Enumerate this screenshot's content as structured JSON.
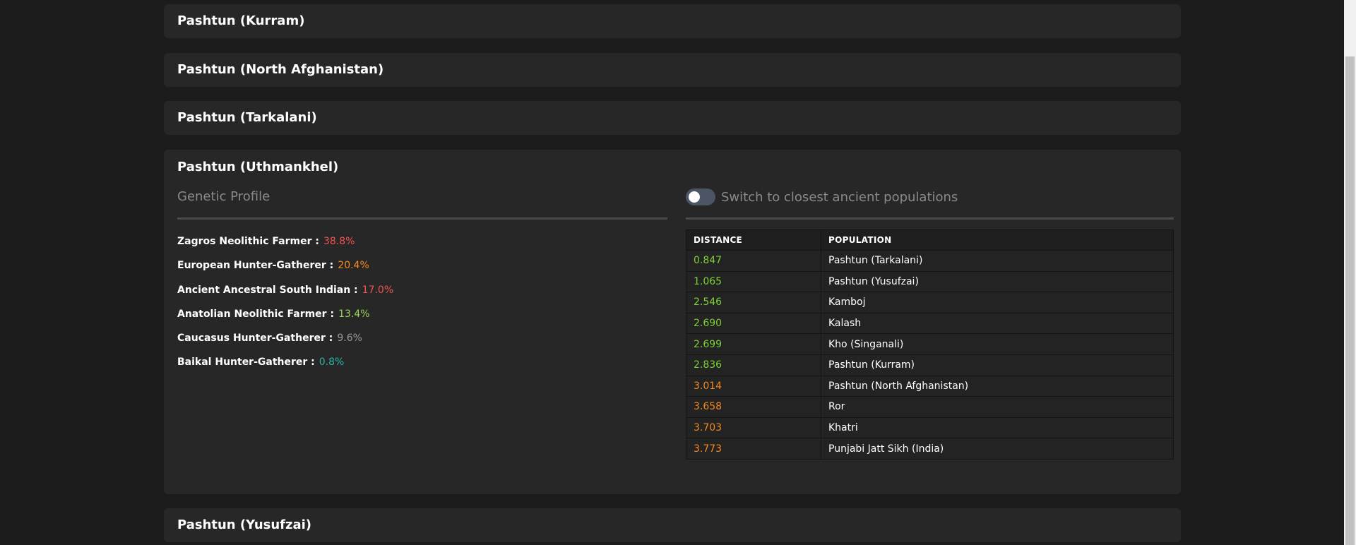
{
  "accordions": {
    "kurram": "Pashtun (Kurram)",
    "north": "Pashtun (North Afghanistan)",
    "tarkalani": "Pashtun (Tarkalani)",
    "uthmankhel": "Pashtun (Uthmankhel)",
    "yusufzai": "Pashtun (Yusufzai)"
  },
  "genetic_profile": {
    "title": "Genetic Profile",
    "items": [
      {
        "name": "Zagros Neolithic Farmer :",
        "pct": "38.8%",
        "color": "#f05252"
      },
      {
        "name": "European Hunter-Gatherer :",
        "pct": "20.4%",
        "color": "#f5891f"
      },
      {
        "name": "Ancient Ancestral South Indian :",
        "pct": "17.0%",
        "color": "#f05252"
      },
      {
        "name": "Anatolian Neolithic Farmer :",
        "pct": "13.4%",
        "color": "#9bd55a"
      },
      {
        "name": "Caucasus Hunter-Gatherer :",
        "pct": "9.6%",
        "color": "#9a9a9a"
      },
      {
        "name": "Baikal Hunter-Gatherer :",
        "pct": "0.8%",
        "color": "#2ab3a6"
      }
    ]
  },
  "toggle": {
    "label": "Switch to closest ancient populations",
    "checked": false
  },
  "distance_table": {
    "headers": [
      "DISTANCE",
      "POPULATION"
    ],
    "rows": [
      {
        "distance": "0.847",
        "population": "Pashtun (Tarkalani)",
        "color": "#7cd137"
      },
      {
        "distance": "1.065",
        "population": "Pashtun (Yusufzai)",
        "color": "#7cd137"
      },
      {
        "distance": "2.546",
        "population": "Kamboj",
        "color": "#7cd137"
      },
      {
        "distance": "2.690",
        "population": "Kalash",
        "color": "#7cd137"
      },
      {
        "distance": "2.699",
        "population": "Kho (Singanali)",
        "color": "#7cd137"
      },
      {
        "distance": "2.836",
        "population": "Pashtun (Kurram)",
        "color": "#7cd137"
      },
      {
        "distance": "3.014",
        "population": "Pashtun (North Afghanistan)",
        "color": "#f5891f"
      },
      {
        "distance": "3.658",
        "population": "Ror",
        "color": "#f5891f"
      },
      {
        "distance": "3.703",
        "population": "Khatri",
        "color": "#f5891f"
      },
      {
        "distance": "3.773",
        "population": "Punjabi Jatt Sikh (India)",
        "color": "#f5891f"
      }
    ]
  }
}
